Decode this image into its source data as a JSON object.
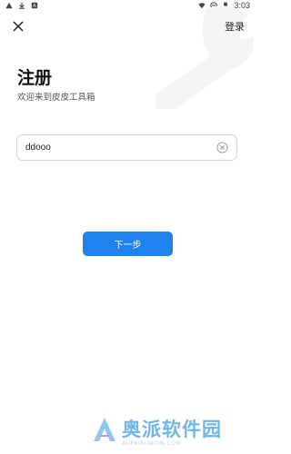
{
  "status_bar": {
    "time": "3:03",
    "left_icons": [
      "warning-icon",
      "download-icon",
      "app-notification-icon"
    ],
    "right_icons": [
      "wifi-icon",
      "do-not-disturb-icon",
      "battery-icon"
    ]
  },
  "header": {
    "close_icon": "close-icon",
    "login_label": "登录"
  },
  "page": {
    "title": "注册",
    "subtitle": "欢迎来到皮皮工具箱"
  },
  "form": {
    "username_value": "ddooo",
    "clear_icon": "clear-circle-icon"
  },
  "actions": {
    "next_label": "下一步",
    "accent_color": "#1e82f0"
  },
  "watermark": {
    "text": "奥派软件园",
    "subtext": "AUPAIRUNION.COM"
  }
}
